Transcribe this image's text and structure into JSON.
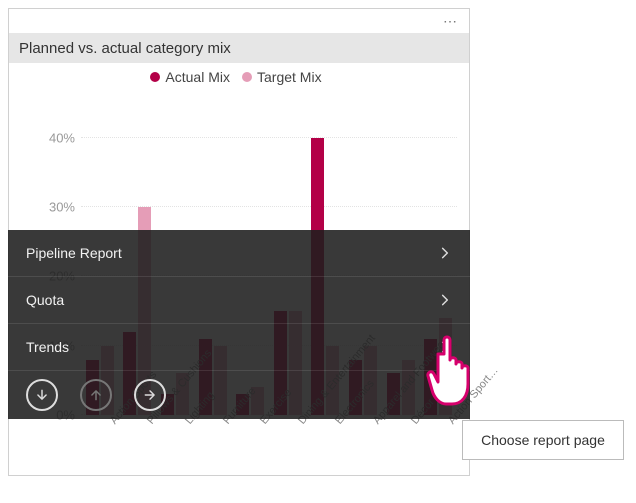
{
  "card": {
    "more_dots": "⋯",
    "title": "Planned vs. actual category mix",
    "legend": [
      {
        "label": "Actual Mix",
        "color": "#b30047"
      },
      {
        "label": "Target Mix",
        "color": "#e59db7"
      }
    ]
  },
  "chart_data": {
    "type": "bar",
    "title": "Planned vs. actual category mix",
    "xlabel": "",
    "ylabel": "",
    "ylim": [
      0,
      45
    ],
    "ticks": [
      0,
      10,
      20,
      30,
      40
    ],
    "tick_labels": [
      "0%",
      "10%",
      "20%",
      "30%",
      "40%"
    ],
    "categories": [
      "Action Sports",
      "Pillows & Cushions",
      "Lighting",
      "Furniture",
      "Exercise",
      "Dining & Entertainment",
      "Electronics",
      "Apparel and Footwear",
      "Décor",
      "Action Sport…"
    ],
    "series": [
      {
        "name": "Actual Mix",
        "color": "#b30047",
        "values": [
          8,
          12,
          3,
          11,
          3,
          15,
          40,
          8,
          6,
          11
        ]
      },
      {
        "name": "Target Mix",
        "color": "#e59db7",
        "values": [
          10,
          30,
          6,
          10,
          4,
          15,
          10,
          10,
          8,
          14
        ]
      }
    ]
  },
  "menu": {
    "items": [
      {
        "label": "Pipeline Report"
      },
      {
        "label": "Quota"
      },
      {
        "label": "Trends"
      }
    ],
    "actions": {
      "down": "arrow-down-circle",
      "up": "arrow-up-circle",
      "right": "arrow-right-circle",
      "close": "close"
    }
  },
  "tooltip": {
    "text": "Choose report page"
  }
}
